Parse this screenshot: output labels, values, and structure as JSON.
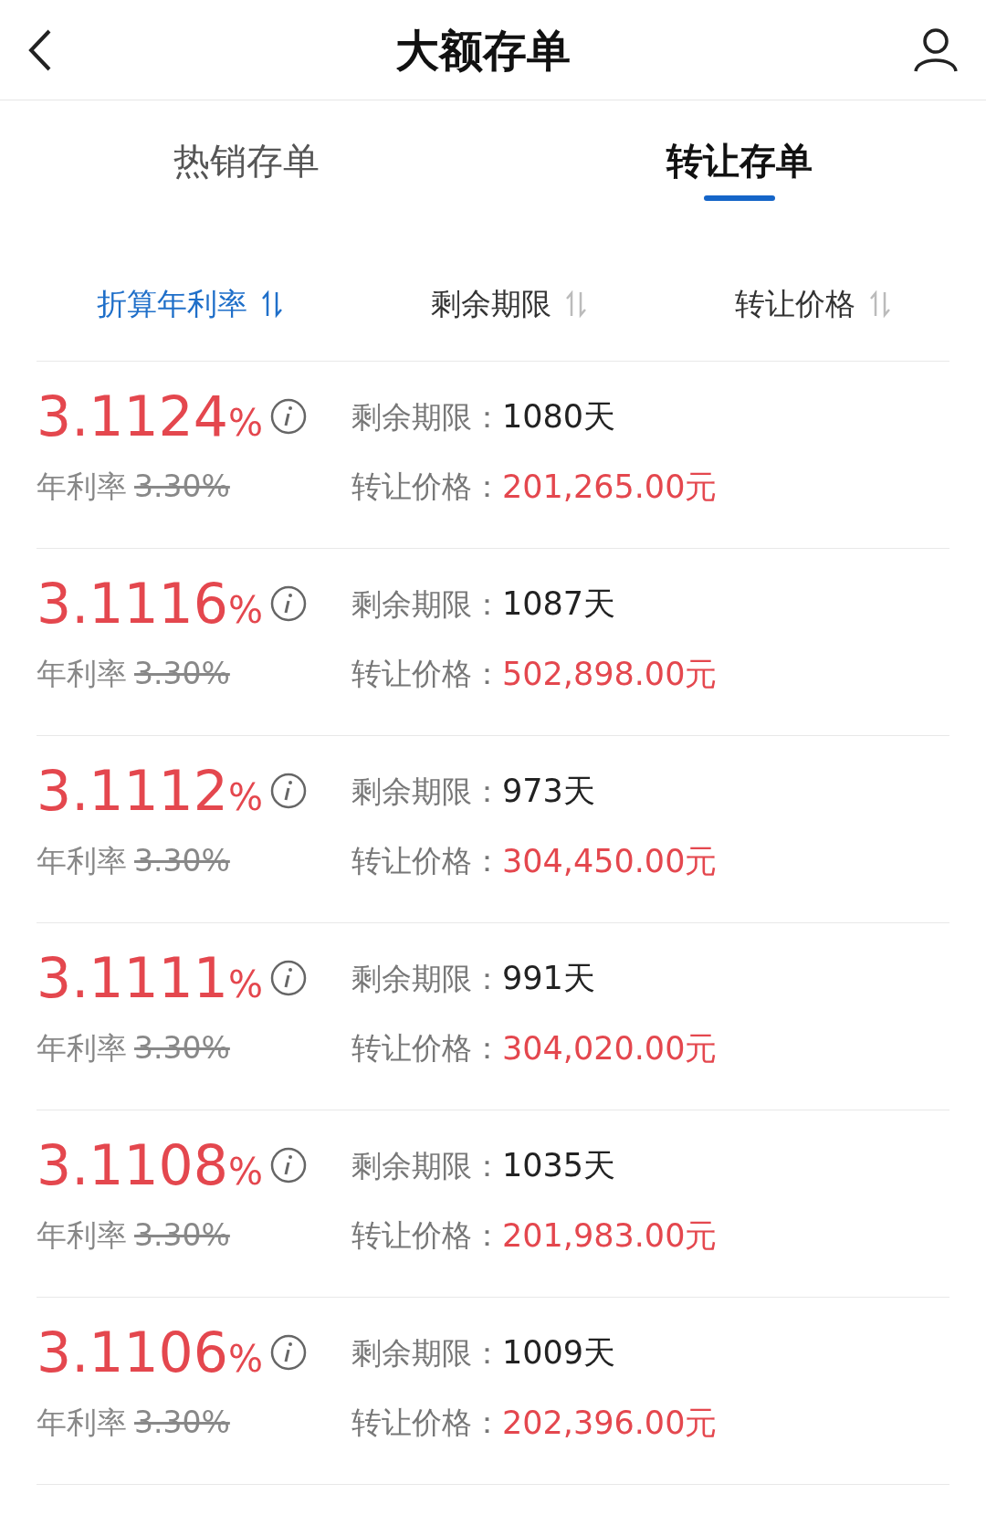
{
  "header": {
    "title": "大额存单"
  },
  "tabs": [
    {
      "label": "热销存单",
      "selected": false
    },
    {
      "label": "转让存单",
      "selected": true
    }
  ],
  "sort_options": [
    {
      "label": "折算年利率",
      "selected": true
    },
    {
      "label": "剩余期限",
      "selected": false
    },
    {
      "label": "转让价格",
      "selected": false
    }
  ],
  "deposits": [
    {
      "rate": "3.1124",
      "rate_unit": "%",
      "original_rate_label": "年利率",
      "original_rate": "3.30%",
      "term_label": "剩余期限：",
      "term": "1080天",
      "price_label": "转让价格：",
      "price": "201,265.00元"
    },
    {
      "rate": "3.1116",
      "rate_unit": "%",
      "original_rate_label": "年利率",
      "original_rate": "3.30%",
      "term_label": "剩余期限：",
      "term": "1087天",
      "price_label": "转让价格：",
      "price": "502,898.00元"
    },
    {
      "rate": "3.1112",
      "rate_unit": "%",
      "original_rate_label": "年利率",
      "original_rate": "3.30%",
      "term_label": "剩余期限：",
      "term": "973天",
      "price_label": "转让价格：",
      "price": "304,450.00元"
    },
    {
      "rate": "3.1111",
      "rate_unit": "%",
      "original_rate_label": "年利率",
      "original_rate": "3.30%",
      "term_label": "剩余期限：",
      "term": "991天",
      "price_label": "转让价格：",
      "price": "304,020.00元"
    },
    {
      "rate": "3.1108",
      "rate_unit": "%",
      "original_rate_label": "年利率",
      "original_rate": "3.30%",
      "term_label": "剩余期限：",
      "term": "1035天",
      "price_label": "转让价格：",
      "price": "201,983.00元"
    },
    {
      "rate": "3.1106",
      "rate_unit": "%",
      "original_rate_label": "年利率",
      "original_rate": "3.30%",
      "term_label": "剩余期限：",
      "term": "1009天",
      "price_label": "转让价格：",
      "price": "202,396.00元"
    }
  ]
}
